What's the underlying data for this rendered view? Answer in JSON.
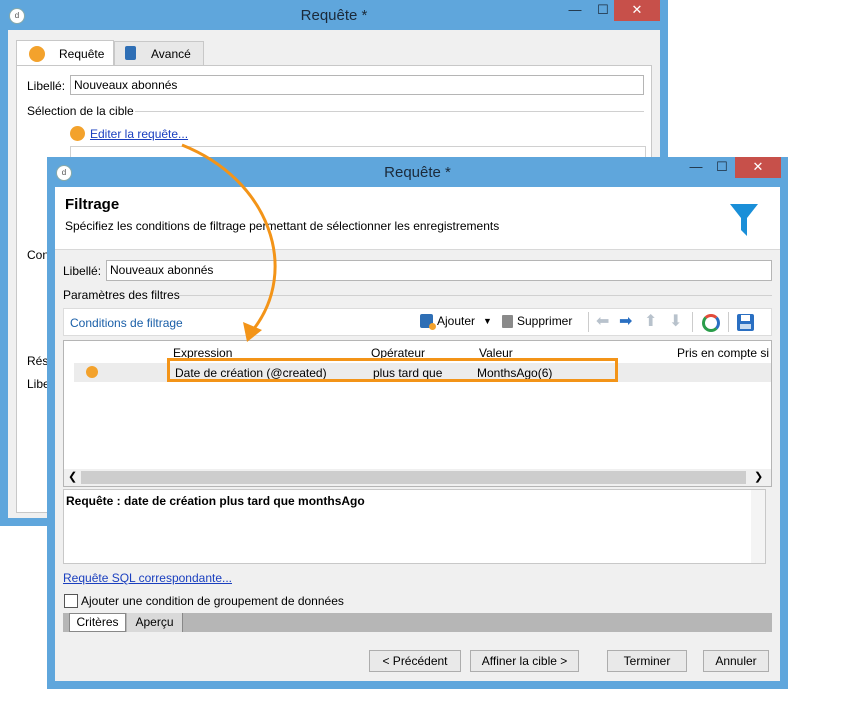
{
  "back_window": {
    "title": "Requête *",
    "controls": {
      "minimize": "—",
      "maximize": "☐",
      "close": "✕"
    },
    "tabs": [
      {
        "label": "Requête",
        "icon": "orange-circle-icon"
      },
      {
        "label": "Avancé",
        "icon": "clipboard-icon"
      }
    ],
    "label_caption": "Libellé:",
    "label_value": "Nouveaux abonnés",
    "target_section": "Sélection de la cible",
    "edit_query_link": "Editer la requête...",
    "partial_labels": [
      "Con",
      "Résu",
      "Libe"
    ]
  },
  "front_window": {
    "title": "Requête *",
    "controls": {
      "minimize": "—",
      "maximize": "☐",
      "close": "✕"
    },
    "header": {
      "title": "Filtrage",
      "subtitle": "Spécifiez les conditions de filtrage permettant de sélectionner les enregistrements",
      "icon": "funnel-icon",
      "icon_color": "#1a8fd8"
    },
    "label_caption": "Libellé:",
    "label_value": "Nouveaux abonnés",
    "params_section": "Paramètres des filtres",
    "toolbar": {
      "conditions_label": "Conditions de filtrage",
      "add_label": "Ajouter",
      "delete_label": "Supprimer"
    },
    "grid": {
      "columns": [
        "Expression",
        "Opérateur",
        "Valeur",
        "Pris en compte si"
      ],
      "rows": [
        {
          "expression": "Date de création (@created)",
          "operator": "plus tard que",
          "value": "MonthsAgo(6)"
        }
      ]
    },
    "query_summary": "Requête : date de création plus tard que monthsAgo",
    "sql_link": "Requête SQL correspondante...",
    "group_checkbox_label": "Ajouter une condition de groupement de données",
    "bottom_tabs": [
      "Critères",
      "Aperçu"
    ],
    "buttons": {
      "previous": "< Précédent",
      "next": "Affiner la cible >",
      "finish": "Terminer",
      "cancel": "Annuler"
    }
  },
  "colors": {
    "window_frame": "#5fa6dc",
    "highlight_orange": "#f39418",
    "link_blue": "#1a3fbf",
    "close_red": "#c7504a"
  }
}
